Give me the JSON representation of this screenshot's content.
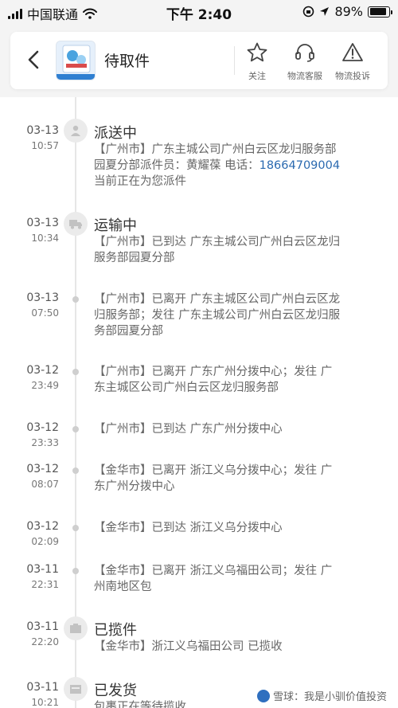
{
  "status_bar": {
    "carrier": "中国联通",
    "time": "下午 2:40",
    "battery": "89%",
    "battery_level": 0.89
  },
  "header": {
    "title": "待取件",
    "actions": [
      {
        "label": "关注",
        "icon": "star-icon"
      },
      {
        "label": "物流客服",
        "icon": "headset-icon"
      },
      {
        "label": "物流投诉",
        "icon": "warning-icon"
      }
    ]
  },
  "timeline": [
    {
      "date": "03-13",
      "time": "10:57",
      "status": "派送中",
      "icon": "person-icon",
      "text_lines": [
        "【广州市】广东主城公司广州白云区龙归服务部",
        "园夏分部派件员：黄耀葆 电话："
      ],
      "phone": "18664709004",
      "extra_line": "当前正在为您派件"
    },
    {
      "date": "03-13",
      "time": "10:34",
      "status": "运输中",
      "icon": "truck-icon",
      "text_lines": [
        "【广州市】已到达 广东主城公司广州白云区龙归",
        "服务部园夏分部"
      ]
    },
    {
      "date": "03-13",
      "time": "07:50",
      "text_lines": [
        "【广州市】已离开 广东主城区公司广州白云区龙",
        "归服务部；发往 广东主城公司广州白云区龙归服",
        "务部园夏分部"
      ]
    },
    {
      "date": "03-12",
      "time": "23:49",
      "text_lines": [
        "【广州市】已离开 广东广州分拨中心；发往 广",
        "东主城区公司广州白云区龙归服务部"
      ]
    },
    {
      "date": "03-12",
      "time": "23:33",
      "text_lines": [
        "【广州市】已到达 广东广州分拨中心"
      ]
    },
    {
      "date": "03-12",
      "time": "08:07",
      "text_lines": [
        "【金华市】已离开 浙江义乌分拨中心；发往 广",
        "东广州分拨中心"
      ]
    },
    {
      "date": "03-12",
      "time": "02:09",
      "text_lines": [
        "【金华市】已到达 浙江义乌分拨中心"
      ]
    },
    {
      "date": "03-11",
      "time": "22:31",
      "text_lines": [
        "【金华市】已离开 浙江义乌福田公司；发往 广",
        "州南地区包"
      ]
    },
    {
      "date": "03-11",
      "time": "22:20",
      "status": "已揽件",
      "icon": "box-icon",
      "text_lines": [
        "【金华市】浙江义乌福田公司 已揽收"
      ]
    },
    {
      "date": "03-11",
      "time": "10:21",
      "status": "已发货",
      "icon": "package-icon",
      "text_lines": [
        "包裹正在等待揽收"
      ]
    }
  ],
  "watermark": "雪球：我是小驯价值投资"
}
